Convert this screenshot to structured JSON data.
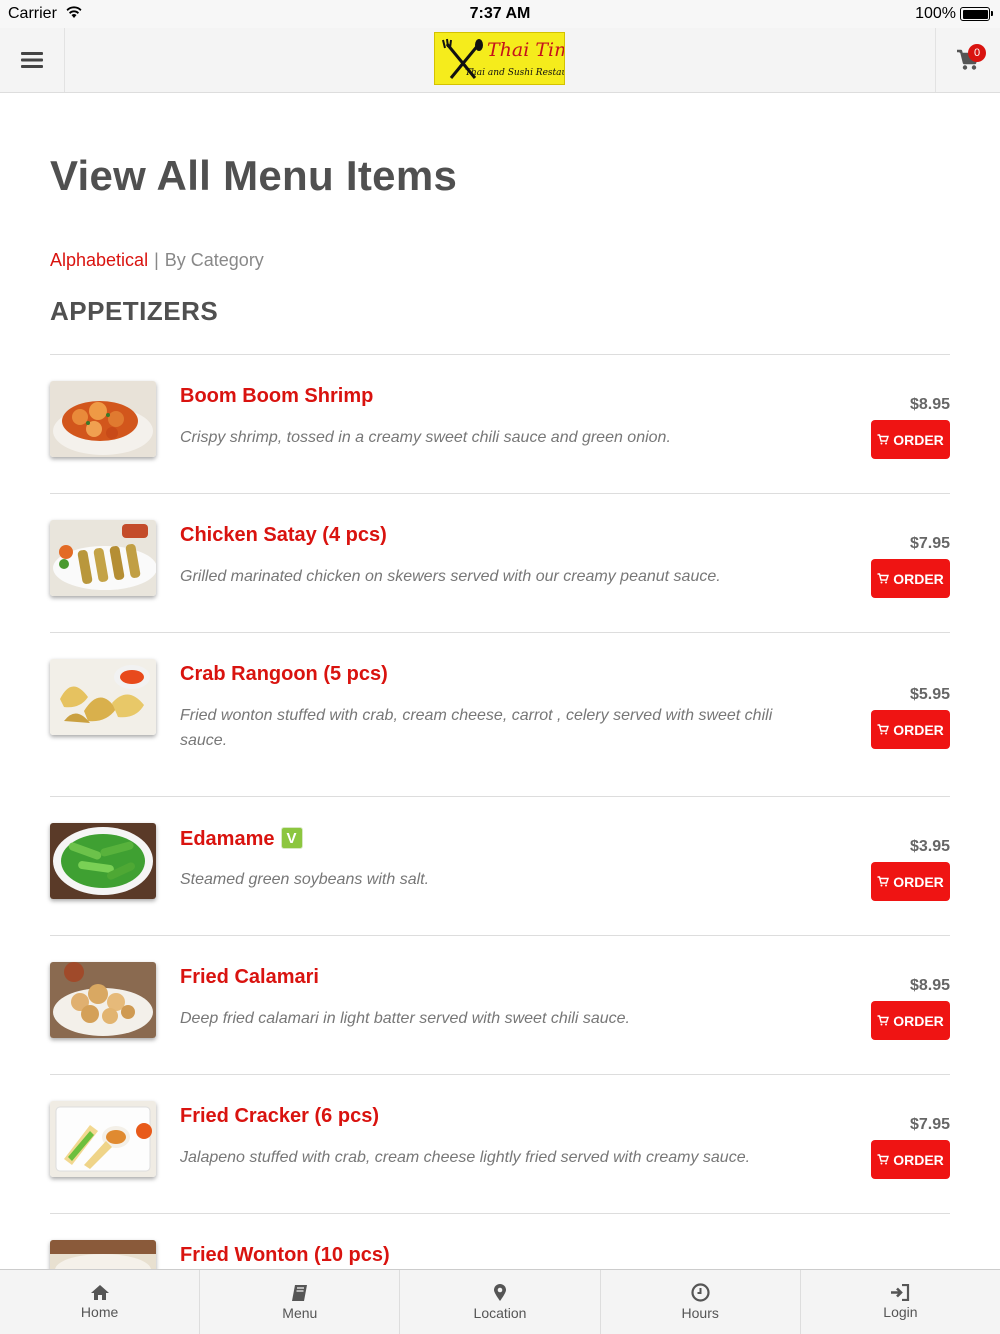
{
  "status_bar": {
    "carrier": "Carrier",
    "time": "7:37 AM",
    "battery": "100%"
  },
  "header": {
    "logo_title": "Thai Time",
    "logo_subtitle": "Thai and Sushi Restaurant",
    "cart_count": "0"
  },
  "page": {
    "title": "View All Menu Items",
    "sort_alphabetical": "Alphabetical",
    "sort_separator": "|",
    "sort_category": "By Category",
    "section": "APPETIZERS"
  },
  "order_label": "ORDER",
  "items": [
    {
      "name": "Boom Boom Shrimp",
      "desc": "Crispy shrimp, tossed in a creamy sweet chili sauce and green onion.",
      "price": "$8.95"
    },
    {
      "name": "Chicken Satay (4 pcs)",
      "desc": "Grilled marinated chicken on skewers served with our creamy peanut sauce.",
      "price": "$7.95"
    },
    {
      "name": "Crab Rangoon (5 pcs)",
      "desc": "Fried wonton stuffed with crab, cream cheese, carrot , celery served with sweet chili sauce.",
      "price": "$5.95"
    },
    {
      "name": "Edamame",
      "badge": "V",
      "desc": "Steamed green soybeans with salt.",
      "price": "$3.95"
    },
    {
      "name": "Fried Calamari",
      "desc": "Deep fried calamari in light batter served with sweet chili sauce.",
      "price": "$8.95"
    },
    {
      "name": "Fried Cracker (6 pcs)",
      "desc": "Jalapeno stuffed with crab, cream cheese lightly fried served with creamy sauce.",
      "price": "$7.95"
    },
    {
      "name": "Fried Wonton (10 pcs)"
    }
  ],
  "tabs": [
    {
      "label": "Home",
      "icon": "home-icon"
    },
    {
      "label": "Menu",
      "icon": "book-icon"
    },
    {
      "label": "Location",
      "icon": "map-pin-icon"
    },
    {
      "label": "Hours",
      "icon": "clock-icon"
    },
    {
      "label": "Login",
      "icon": "sign-in-icon"
    }
  ],
  "colors": {
    "accent": "#d9130f",
    "button": "#ef1413",
    "veg": "#8cc63f"
  }
}
